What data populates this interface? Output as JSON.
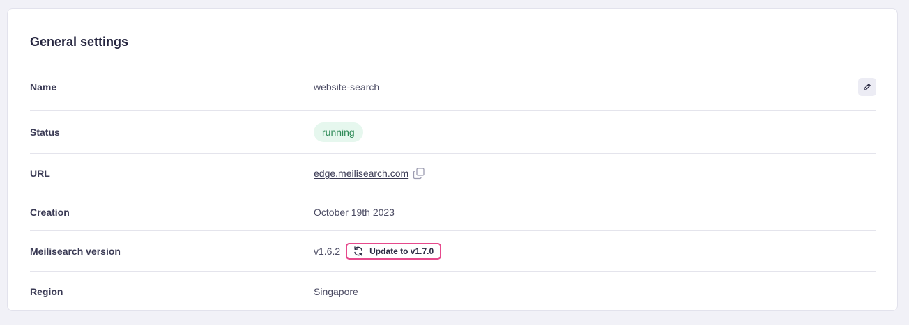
{
  "card": {
    "title": "General settings"
  },
  "rows": {
    "name": {
      "label": "Name",
      "value": "website-search",
      "edit_icon": "pencil-icon"
    },
    "status": {
      "label": "Status",
      "value": "running",
      "color": "#2e8a57",
      "bg": "#e6f7ee"
    },
    "url": {
      "label": "URL",
      "value": "edge.meilisearch.com",
      "copy_icon": "copy-icon"
    },
    "creation": {
      "label": "Creation",
      "value": "October 19th 2023"
    },
    "version": {
      "label": "Meilisearch version",
      "value": "v1.6.2",
      "update_label": "Update to v1.7.0",
      "accent": "#e6498c",
      "update_icon": "refresh-icon"
    },
    "region": {
      "label": "Region",
      "value": "Singapore"
    }
  }
}
